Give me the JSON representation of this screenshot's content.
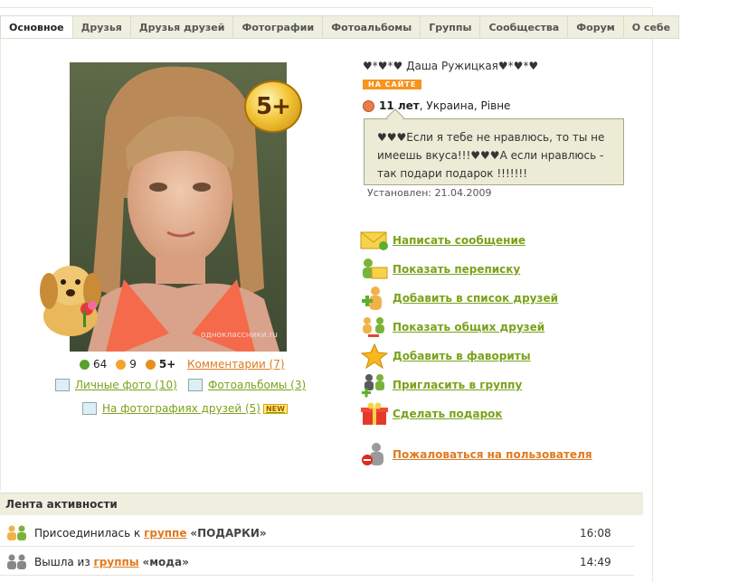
{
  "tabs": [
    {
      "label": "Основное",
      "active": true
    },
    {
      "label": "Друзья"
    },
    {
      "label": "Друзья друзей"
    },
    {
      "label": "Фотографии"
    },
    {
      "label": "Фотоальбомы"
    },
    {
      "label": "Группы"
    },
    {
      "label": "Сообщества"
    },
    {
      "label": "Форум"
    },
    {
      "label": "О себе"
    }
  ],
  "profile": {
    "badge": "5+",
    "watermark": "одноклассники.ru",
    "name": "♥*♥*♥ Даша Ружицкая♥*♥*♥",
    "online": "НА САЙТЕ",
    "age": "11 лет",
    "location": ", Украина, Рівне",
    "status": "♥♥♥Если я тебе не нравлюсь, то ты не имеешь вкуса!!!♥♥♥А если нравлюсь - так подари подарок !!!!!!!",
    "installed": "Установлен: 21.04.2009"
  },
  "stats": {
    "green": "64",
    "orange": "9",
    "rating": "5+",
    "comments": "Комментарии (7)"
  },
  "photo_links": {
    "personal": "Личные фото (10)",
    "albums": "Фотоальбомы (3)",
    "friends_photos": "На фотографиях друзей (5)",
    "new_tag": "NEW"
  },
  "actions": [
    {
      "label": "Написать сообщение",
      "icon": "envelope-icon"
    },
    {
      "label": "Показать переписку",
      "icon": "conversation-icon"
    },
    {
      "label": "Добавить в список друзей",
      "icon": "add-friend-icon"
    },
    {
      "label": "Показать общих друзей",
      "icon": "common-friends-icon"
    },
    {
      "label": "Добавить в фавориты",
      "icon": "star-icon"
    },
    {
      "label": "Пригласить в группу",
      "icon": "invite-group-icon"
    },
    {
      "label": "Сделать подарок",
      "icon": "gift-icon"
    },
    {
      "label": "Пожаловаться на пользователя",
      "icon": "complain-icon"
    }
  ],
  "feed": {
    "title": "Лента активности",
    "rows": [
      {
        "prefix": "Присоединилась к ",
        "link": "группе",
        "group": "«ПОДАРКИ»",
        "time": "16:08"
      },
      {
        "prefix": "Вышла из ",
        "link": "группы",
        "group": "«мода»",
        "time": "14:49"
      }
    ]
  },
  "colors": {
    "accent_green": "#7aa21a",
    "accent_orange": "#e07a1f",
    "tab_bg": "#efefe0"
  }
}
